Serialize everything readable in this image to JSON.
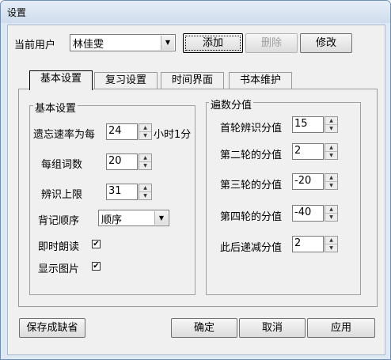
{
  "window": {
    "title": "设置"
  },
  "user": {
    "label": "当前用户",
    "value": "林佳雯"
  },
  "user_buttons": {
    "add": "添加",
    "delete": "删除",
    "edit": "修改"
  },
  "tabs": [
    {
      "label": "基本设置"
    },
    {
      "label": "复习设置"
    },
    {
      "label": "时间界面"
    },
    {
      "label": "书本维护"
    }
  ],
  "basic": {
    "legend": "基本设置",
    "forget_rate": {
      "prefix": "遗忘速率为每",
      "value": "24",
      "suffix": "小时1分"
    },
    "group_words": {
      "label": "每组词数",
      "value": "20"
    },
    "recognize_limit": {
      "label": "辨识上限",
      "value": "31"
    },
    "order": {
      "label": "背记顺序",
      "value": "顺序"
    },
    "instant_read": {
      "label": "即时朗读",
      "checked": "✔"
    },
    "show_image": {
      "label": "显示图片",
      "checked": "✔"
    }
  },
  "scores": {
    "legend": "遍数分值",
    "first": {
      "label": "首轮辨识分值",
      "value": "15"
    },
    "second": {
      "label": "第二轮的分值",
      "value": "2"
    },
    "third": {
      "label": "第三轮的分值",
      "value": "-20"
    },
    "fourth": {
      "label": "第四轮的分值",
      "value": "-40"
    },
    "after": {
      "label": "此后递减分值",
      "value": "2"
    }
  },
  "footer": {
    "save_default": "保存成缺省",
    "ok": "确定",
    "cancel": "取消",
    "apply": "应用"
  }
}
